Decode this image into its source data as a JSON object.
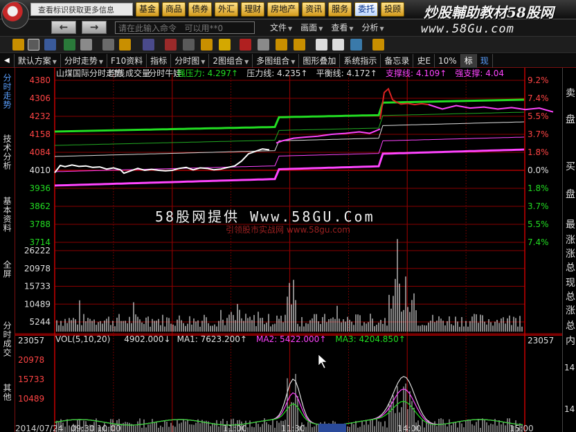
{
  "topbar": {
    "notice": "查看标识获取更多信息",
    "nav": [
      "基金",
      "商品",
      "债券",
      "外汇",
      "理财",
      "房地产",
      "资讯",
      "服务",
      "委托",
      "投顾"
    ],
    "active_nav": 8,
    "banner": "炒股輔助教材58股网"
  },
  "cmd": {
    "back": "←",
    "forward": "→",
    "input_value": "请在此输入命令   可以用**0",
    "menus": [
      "文件",
      "画面",
      "查看",
      "分析"
    ],
    "banner": "www.58Gu.com"
  },
  "tabs": [
    {
      "label": "默认方案",
      "caret": true
    },
    {
      "label": "分时走势",
      "caret": true
    },
    {
      "label": "F10资料",
      "caret": false
    },
    {
      "label": "指标",
      "caret": false
    },
    {
      "label": "分时图",
      "caret": true
    },
    {
      "label": "2图组合",
      "caret": true
    },
    {
      "label": "多图组合",
      "caret": true
    },
    {
      "label": "图形叠加",
      "caret": false
    },
    {
      "label": "系统指示",
      "caret": false
    },
    {
      "label": "备忘录",
      "caret": false
    },
    {
      "label": "史E",
      "caret": false
    },
    {
      "label": "10%",
      "caret": false
    },
    {
      "label": "标",
      "caret": false
    },
    {
      "label": "现",
      "caret": false
    }
  ],
  "left_tabs": [
    "分时走势",
    "技术分析",
    "基本资料",
    "全屏",
    "分时成交",
    "其他"
  ],
  "right_panel": [
    "卖",
    "盘",
    "买",
    "盘",
    "最",
    "涨",
    "涨",
    "总",
    "现",
    "总",
    "涨",
    "总",
    "内",
    "14",
    "14"
  ],
  "chart_data": {
    "type": "line",
    "title": "山煤国际分时走势",
    "header_items": [
      {
        "text": "山煤国际分时走势",
        "color": "#e0e0e0"
      },
      {
        "text": "均线",
        "color": "#e0e0e0"
      },
      {
        "text": "成交量",
        "color": "#e0e0e0"
      },
      {
        "text": "分时牛娃",
        "color": "#e0e0e0"
      },
      {
        "text": "强压力: 4.297↑",
        "color": "#22dd22"
      },
      {
        "text": "压力线: 4.235↑",
        "color": "#e0e0e0"
      },
      {
        "text": "平衡线: 4.172↑",
        "color": "#e0e0e0"
      },
      {
        "text": "支撑线: 4.109↑",
        "color": "#ff44ff"
      },
      {
        "text": "强支撑: 4.04",
        "color": "#ff44ff"
      }
    ],
    "price_ticks": [
      "4380",
      "4306",
      "4232",
      "4158",
      "4084",
      "4010",
      "3936",
      "3862",
      "3788",
      "3714"
    ],
    "pct_ticks": [
      "9.2%",
      "7.4%",
      "5.5%",
      "3.7%",
      "1.8%",
      "0.0%",
      "1.8%",
      "3.7%",
      "5.5%",
      "7.4%"
    ],
    "price_ylim": [
      3714,
      4380
    ],
    "base_price": 4010,
    "price_series": {
      "name": "price",
      "color": "#ffffff",
      "x": [
        0,
        8,
        15,
        25,
        35,
        45,
        55,
        65,
        75,
        85,
        95,
        100,
        110,
        120,
        130,
        140,
        150,
        160,
        170,
        180,
        190,
        200,
        210,
        220,
        230,
        240,
        250,
        260,
        270,
        280,
        300,
        310
      ],
      "values": [
        4000,
        4030,
        4025,
        4032,
        4026,
        4028,
        4022,
        4024,
        4015,
        4020,
        4012,
        3998,
        4008,
        4018,
        4010,
        4014,
        4010,
        4008,
        4010,
        4018,
        4022,
        4012,
        4020,
        4018,
        4012,
        4015,
        4022,
        4028,
        4048,
        4078,
        4098,
        4094
      ]
    },
    "price_series_pink": {
      "name": "price-after",
      "color": "#ff44ff",
      "x": [
        320,
        330,
        345,
        360,
        380,
        400,
        420,
        440,
        455,
        462,
        470
      ],
      "values": [
        4122,
        4132,
        4142,
        4146,
        4150,
        4158,
        4162,
        4168,
        4162,
        4170,
        4180
      ]
    },
    "price_series_red": {
      "name": "price-peak",
      "color": "#dd2222",
      "x": [
        470,
        476,
        482,
        488,
        494,
        500,
        510,
        520,
        530,
        540
      ],
      "values": [
        4220,
        4330,
        4345,
        4300,
        4290,
        4282,
        4285,
        4280,
        4284,
        4280
      ]
    },
    "price_series_pink2": {
      "name": "price-late",
      "color": "#ff44ff",
      "x": [
        540,
        560,
        580,
        600,
        620,
        640,
        660,
        680,
        700,
        720
      ],
      "values": [
        4280,
        4262,
        4276,
        4266,
        4270,
        4262,
        4268,
        4260,
        4266,
        4250
      ]
    },
    "volume_ticks": [
      "26222",
      "20978",
      "15733",
      "10489",
      "5244"
    ],
    "volume_ylim": [
      0,
      26222
    ],
    "vol_header": [
      {
        "text": "VOL(5,10,20)",
        "color": "#e0e0e0"
      },
      {
        "text": "4902.000↓",
        "color": "#e0e0e0"
      },
      {
        "text": "MA1: 7623.200↑",
        "color": "#e0e0e0"
      },
      {
        "text": "MA2: 5422.000↑",
        "color": "#ff44ff"
      },
      {
        "text": "MA3: 4204.850↑",
        "color": "#22dd22"
      }
    ],
    "lower_ticks": [
      "23057",
      "20978",
      "15733",
      "10489"
    ],
    "right_lower_tick": "23057",
    "time_ticks": [
      "2014/07/24",
      "09:30",
      "10:00",
      "11:00",
      "11:30",
      "13:14",
      "14:00",
      "15:00"
    ],
    "watermark_main": "58股网提供 Www.58GU.Com",
    "watermark_sub": "引领股市实战网 www.58gu.com"
  },
  "colors": {
    "grid": "#8b0000",
    "price_axis": "#ff4444",
    "pct_up": "#ff4444",
    "pct_down": "#22dd22",
    "volume_bar": "#e0e0e0",
    "pressure": "#22dd22",
    "support": "#ff44ff",
    "accent": "#ffcc33"
  }
}
